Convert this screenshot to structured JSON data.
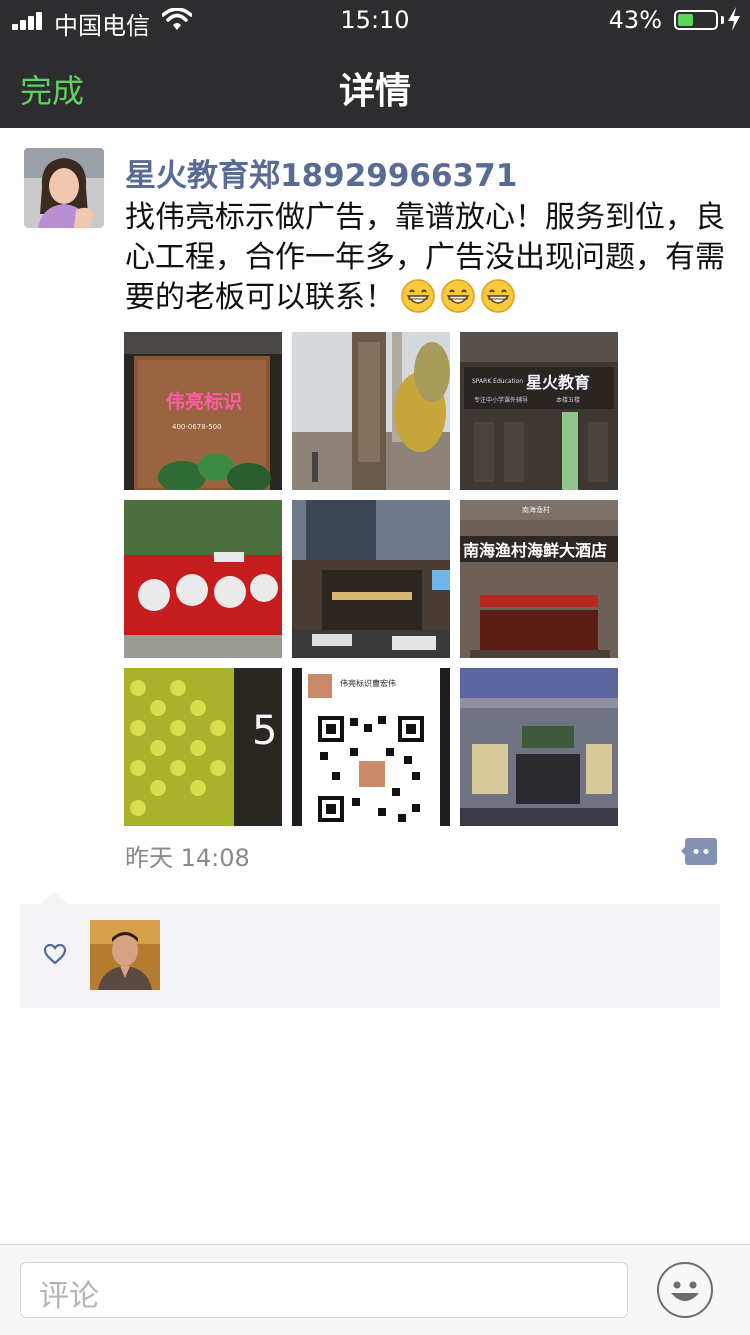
{
  "status_bar": {
    "carrier": "中国电信",
    "time": "15:10",
    "battery_percent": "43%",
    "battery_level": 0.43
  },
  "nav": {
    "done_label": "完成",
    "title": "详情"
  },
  "post": {
    "author": "星火教育郑18929966371",
    "text": "找伟亮标示做广告，靠谱放心！服务到位，良心工程，合作一年多，广告没出现问题，有需要的老板可以联系！",
    "emojis": [
      "grin-icon",
      "grin-icon",
      "grin-icon"
    ],
    "timestamp": "昨天 14:08",
    "photos": [
      {
        "name": "photo-wood-sign",
        "texts": [
          "伟亮标识",
          "400-0678-500"
        ]
      },
      {
        "name": "photo-pylon-sign",
        "texts": []
      },
      {
        "name": "photo-spark-education",
        "texts": [
          "SPARK Education",
          "星火教育",
          "专注中小学课外辅导",
          "本楼五楼"
        ]
      },
      {
        "name": "photo-red-display",
        "texts": []
      },
      {
        "name": "photo-hotel-night",
        "texts": []
      },
      {
        "name": "photo-seafood-restaurant",
        "texts": [
          "南海渔村海鲜大酒店",
          "南海渔村"
        ]
      },
      {
        "name": "photo-hexagon-wall",
        "texts": [
          "5"
        ]
      },
      {
        "name": "photo-qr-code",
        "texts": [
          "伟亮标识曹宏伟"
        ]
      },
      {
        "name": "photo-storefront-render",
        "texts": []
      }
    ]
  },
  "likes": {
    "icon": "heart-icon",
    "users": [
      "liker-avatar"
    ]
  },
  "comment_bar": {
    "placeholder": "评论",
    "emoji_icon": "smiley-icon"
  }
}
